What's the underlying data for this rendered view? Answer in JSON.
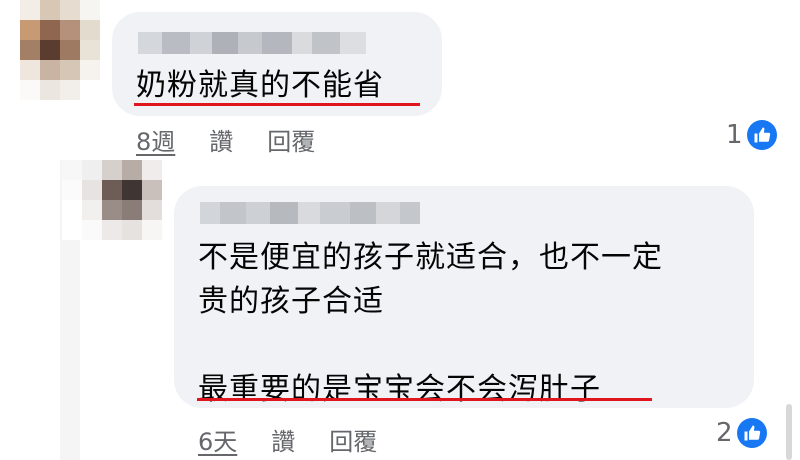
{
  "comments": [
    {
      "text": "奶粉就真的不能省",
      "time": "8週",
      "like_label": "讚",
      "reply_label": "回覆",
      "reaction_count": "1",
      "reaction_icon": "thumbs-up-icon"
    },
    {
      "text_line1": "不是便宜的孩子就适合，也不一定",
      "text_line2": "贵的孩子合适",
      "text_line3": "最重要的是宝宝会不会泻肚子",
      "time": "6天",
      "like_label": "讚",
      "reply_label": "回覆",
      "reaction_count": "2",
      "reaction_icon": "thumbs-up-icon"
    }
  ],
  "colors": {
    "bubble": "#f0f2f5",
    "meta_text": "#65676b",
    "like_blue": "#1877f2",
    "highlight_underline": "#e0161f"
  }
}
